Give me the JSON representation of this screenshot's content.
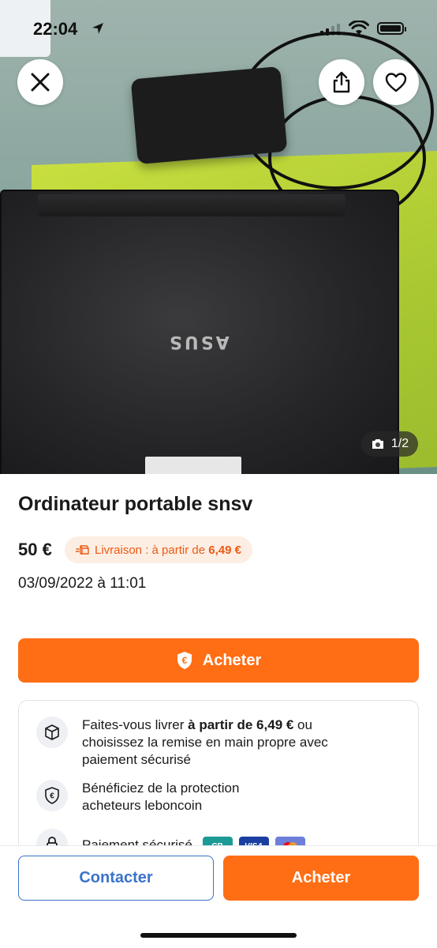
{
  "status_bar": {
    "time": "22:04"
  },
  "photo": {
    "brand_mark": "ASUS",
    "counter": "1/2"
  },
  "listing": {
    "title": "Ordinateur portable snsv",
    "price": "50 €",
    "delivery_prefix": "Livraison : à partir de ",
    "delivery_price": "6,49 €",
    "date": "03/09/2022 à 11:01"
  },
  "buy_button": {
    "label": "Acheter"
  },
  "info": {
    "delivery": {
      "part1": "Faites-vous livrer ",
      "bold": "à partir de 6,49 €",
      "part2": " ou choisissez la remise en main propre avec paiement sécurisé"
    },
    "protection": "Bénéficiez de la protection acheteurs leboncoin",
    "payment": {
      "label": "Paiement sécurisé",
      "cards": [
        "CB",
        "VISA",
        ""
      ]
    }
  },
  "bottom_bar": {
    "contact_label": "Contacter",
    "buy_label": "Acheter"
  },
  "colors": {
    "accent": "#ff6e14",
    "link": "#3a73c9",
    "pill_bg": "#fdeee4"
  }
}
